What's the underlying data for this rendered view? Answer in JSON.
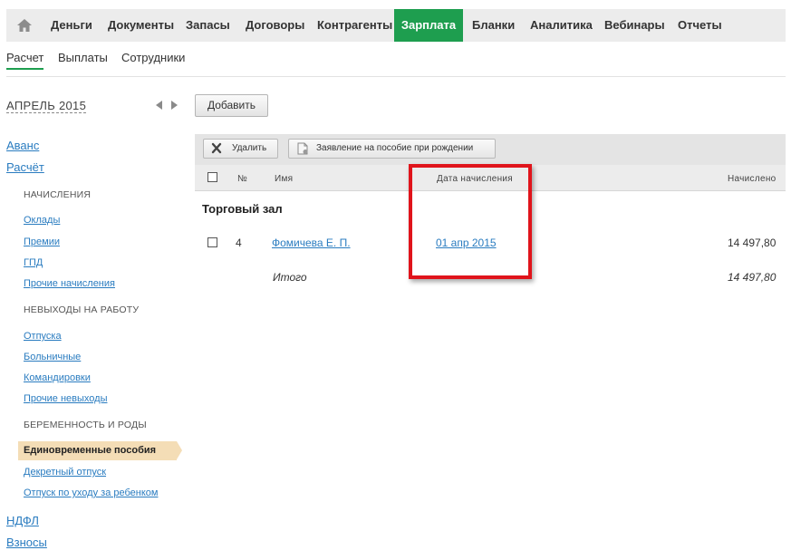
{
  "topnav": {
    "home_icon": "home-icon",
    "items": [
      {
        "label": "Деньги"
      },
      {
        "label": "Документы"
      },
      {
        "label": "Запасы"
      },
      {
        "label": "Договоры"
      },
      {
        "label": "Контрагенты"
      },
      {
        "label": "Зарплата",
        "active": true
      },
      {
        "label": "Бланки"
      },
      {
        "label": "Аналитика"
      },
      {
        "label": "Вебинары"
      },
      {
        "label": "Отчеты"
      }
    ],
    "active_color": "#1e9e4f"
  },
  "subnav": {
    "items": [
      {
        "label": "Расчет",
        "active": true
      },
      {
        "label": "Выплаты"
      },
      {
        "label": "Сотрудники"
      }
    ]
  },
  "sidebar": {
    "period": "АПРЕЛЬ 2015",
    "top_links": [
      "Аванс",
      "Расчёт"
    ],
    "sections": [
      {
        "heading": "НАЧИСЛЕНИЯ",
        "links": [
          "Оклады",
          "Премии",
          "ГПД",
          "Прочие начисления"
        ]
      },
      {
        "heading": "НЕВЫХОДЫ НА РАБОТУ",
        "links": [
          "Отпуска",
          "Больничные",
          "Командировки",
          "Прочие невыходы"
        ]
      },
      {
        "heading": "БЕРЕМЕННОСТЬ И РОДЫ",
        "active_link": "Единовременные пособия",
        "links": [
          "Декретный отпуск",
          "Отпуск по уходу за ребенком"
        ]
      }
    ],
    "bottom_links": [
      "НДФЛ",
      "Взносы"
    ],
    "active_bg": "#f4ddb6"
  },
  "main": {
    "add_button": "Добавить",
    "toolbar": {
      "delete_label": "Удалить",
      "statement_label": "Заявление на пособие при рождении"
    },
    "table": {
      "headers": {
        "num": "№",
        "name": "Имя",
        "date": "Дата начисления",
        "accrued": "Начислено"
      },
      "group": "Торговый зал",
      "rows": [
        {
          "num": "4",
          "name": "Фомичева Е. П.",
          "date": "01 апр 2015",
          "accrued": "14 497,80"
        }
      ],
      "total_label": "Итого",
      "total_value": "14 497,80"
    },
    "highlight_color": "#e0141b"
  }
}
